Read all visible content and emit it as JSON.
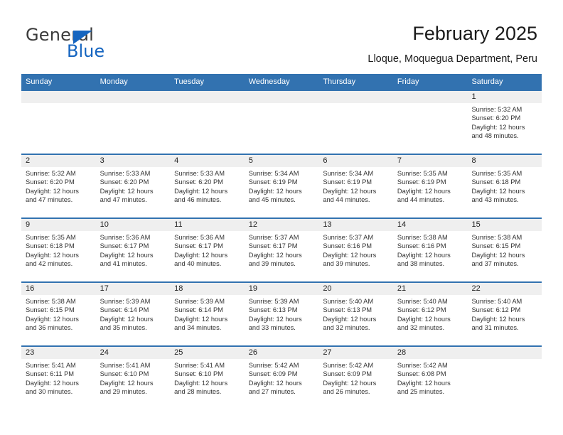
{
  "brand": {
    "name_top": "General",
    "name_bottom": "Blue",
    "triangle_color": "#1565C0",
    "text_color": "#3b3b3b"
  },
  "header": {
    "title": "February 2025",
    "subtitle": "Lloque, Moquegua Department, Peru"
  },
  "colors": {
    "header_blue": "#3272B0",
    "day_band_gray": "#efefef",
    "cell_white": "#ffffff",
    "text": "#222222"
  },
  "weekdays": [
    "Sunday",
    "Monday",
    "Tuesday",
    "Wednesday",
    "Thursday",
    "Friday",
    "Saturday"
  ],
  "weeks": [
    [
      {
        "day": "",
        "sunrise": "",
        "sunset": "",
        "daylight_line1": "",
        "daylight_line2": ""
      },
      {
        "day": "",
        "sunrise": "",
        "sunset": "",
        "daylight_line1": "",
        "daylight_line2": ""
      },
      {
        "day": "",
        "sunrise": "",
        "sunset": "",
        "daylight_line1": "",
        "daylight_line2": ""
      },
      {
        "day": "",
        "sunrise": "",
        "sunset": "",
        "daylight_line1": "",
        "daylight_line2": ""
      },
      {
        "day": "",
        "sunrise": "",
        "sunset": "",
        "daylight_line1": "",
        "daylight_line2": ""
      },
      {
        "day": "",
        "sunrise": "",
        "sunset": "",
        "daylight_line1": "",
        "daylight_line2": ""
      },
      {
        "day": "1",
        "sunrise": "Sunrise: 5:32 AM",
        "sunset": "Sunset: 6:20 PM",
        "daylight_line1": "Daylight: 12 hours",
        "daylight_line2": "and 48 minutes."
      }
    ],
    [
      {
        "day": "2",
        "sunrise": "Sunrise: 5:32 AM",
        "sunset": "Sunset: 6:20 PM",
        "daylight_line1": "Daylight: 12 hours",
        "daylight_line2": "and 47 minutes."
      },
      {
        "day": "3",
        "sunrise": "Sunrise: 5:33 AM",
        "sunset": "Sunset: 6:20 PM",
        "daylight_line1": "Daylight: 12 hours",
        "daylight_line2": "and 47 minutes."
      },
      {
        "day": "4",
        "sunrise": "Sunrise: 5:33 AM",
        "sunset": "Sunset: 6:20 PM",
        "daylight_line1": "Daylight: 12 hours",
        "daylight_line2": "and 46 minutes."
      },
      {
        "day": "5",
        "sunrise": "Sunrise: 5:34 AM",
        "sunset": "Sunset: 6:19 PM",
        "daylight_line1": "Daylight: 12 hours",
        "daylight_line2": "and 45 minutes."
      },
      {
        "day": "6",
        "sunrise": "Sunrise: 5:34 AM",
        "sunset": "Sunset: 6:19 PM",
        "daylight_line1": "Daylight: 12 hours",
        "daylight_line2": "and 44 minutes."
      },
      {
        "day": "7",
        "sunrise": "Sunrise: 5:35 AM",
        "sunset": "Sunset: 6:19 PM",
        "daylight_line1": "Daylight: 12 hours",
        "daylight_line2": "and 44 minutes."
      },
      {
        "day": "8",
        "sunrise": "Sunrise: 5:35 AM",
        "sunset": "Sunset: 6:18 PM",
        "daylight_line1": "Daylight: 12 hours",
        "daylight_line2": "and 43 minutes."
      }
    ],
    [
      {
        "day": "9",
        "sunrise": "Sunrise: 5:35 AM",
        "sunset": "Sunset: 6:18 PM",
        "daylight_line1": "Daylight: 12 hours",
        "daylight_line2": "and 42 minutes."
      },
      {
        "day": "10",
        "sunrise": "Sunrise: 5:36 AM",
        "sunset": "Sunset: 6:17 PM",
        "daylight_line1": "Daylight: 12 hours",
        "daylight_line2": "and 41 minutes."
      },
      {
        "day": "11",
        "sunrise": "Sunrise: 5:36 AM",
        "sunset": "Sunset: 6:17 PM",
        "daylight_line1": "Daylight: 12 hours",
        "daylight_line2": "and 40 minutes."
      },
      {
        "day": "12",
        "sunrise": "Sunrise: 5:37 AM",
        "sunset": "Sunset: 6:17 PM",
        "daylight_line1": "Daylight: 12 hours",
        "daylight_line2": "and 39 minutes."
      },
      {
        "day": "13",
        "sunrise": "Sunrise: 5:37 AM",
        "sunset": "Sunset: 6:16 PM",
        "daylight_line1": "Daylight: 12 hours",
        "daylight_line2": "and 39 minutes."
      },
      {
        "day": "14",
        "sunrise": "Sunrise: 5:38 AM",
        "sunset": "Sunset: 6:16 PM",
        "daylight_line1": "Daylight: 12 hours",
        "daylight_line2": "and 38 minutes."
      },
      {
        "day": "15",
        "sunrise": "Sunrise: 5:38 AM",
        "sunset": "Sunset: 6:15 PM",
        "daylight_line1": "Daylight: 12 hours",
        "daylight_line2": "and 37 minutes."
      }
    ],
    [
      {
        "day": "16",
        "sunrise": "Sunrise: 5:38 AM",
        "sunset": "Sunset: 6:15 PM",
        "daylight_line1": "Daylight: 12 hours",
        "daylight_line2": "and 36 minutes."
      },
      {
        "day": "17",
        "sunrise": "Sunrise: 5:39 AM",
        "sunset": "Sunset: 6:14 PM",
        "daylight_line1": "Daylight: 12 hours",
        "daylight_line2": "and 35 minutes."
      },
      {
        "day": "18",
        "sunrise": "Sunrise: 5:39 AM",
        "sunset": "Sunset: 6:14 PM",
        "daylight_line1": "Daylight: 12 hours",
        "daylight_line2": "and 34 minutes."
      },
      {
        "day": "19",
        "sunrise": "Sunrise: 5:39 AM",
        "sunset": "Sunset: 6:13 PM",
        "daylight_line1": "Daylight: 12 hours",
        "daylight_line2": "and 33 minutes."
      },
      {
        "day": "20",
        "sunrise": "Sunrise: 5:40 AM",
        "sunset": "Sunset: 6:13 PM",
        "daylight_line1": "Daylight: 12 hours",
        "daylight_line2": "and 32 minutes."
      },
      {
        "day": "21",
        "sunrise": "Sunrise: 5:40 AM",
        "sunset": "Sunset: 6:12 PM",
        "daylight_line1": "Daylight: 12 hours",
        "daylight_line2": "and 32 minutes."
      },
      {
        "day": "22",
        "sunrise": "Sunrise: 5:40 AM",
        "sunset": "Sunset: 6:12 PM",
        "daylight_line1": "Daylight: 12 hours",
        "daylight_line2": "and 31 minutes."
      }
    ],
    [
      {
        "day": "23",
        "sunrise": "Sunrise: 5:41 AM",
        "sunset": "Sunset: 6:11 PM",
        "daylight_line1": "Daylight: 12 hours",
        "daylight_line2": "and 30 minutes."
      },
      {
        "day": "24",
        "sunrise": "Sunrise: 5:41 AM",
        "sunset": "Sunset: 6:10 PM",
        "daylight_line1": "Daylight: 12 hours",
        "daylight_line2": "and 29 minutes."
      },
      {
        "day": "25",
        "sunrise": "Sunrise: 5:41 AM",
        "sunset": "Sunset: 6:10 PM",
        "daylight_line1": "Daylight: 12 hours",
        "daylight_line2": "and 28 minutes."
      },
      {
        "day": "26",
        "sunrise": "Sunrise: 5:42 AM",
        "sunset": "Sunset: 6:09 PM",
        "daylight_line1": "Daylight: 12 hours",
        "daylight_line2": "and 27 minutes."
      },
      {
        "day": "27",
        "sunrise": "Sunrise: 5:42 AM",
        "sunset": "Sunset: 6:09 PM",
        "daylight_line1": "Daylight: 12 hours",
        "daylight_line2": "and 26 minutes."
      },
      {
        "day": "28",
        "sunrise": "Sunrise: 5:42 AM",
        "sunset": "Sunset: 6:08 PM",
        "daylight_line1": "Daylight: 12 hours",
        "daylight_line2": "and 25 minutes."
      },
      {
        "day": "",
        "sunrise": "",
        "sunset": "",
        "daylight_line1": "",
        "daylight_line2": ""
      }
    ]
  ]
}
